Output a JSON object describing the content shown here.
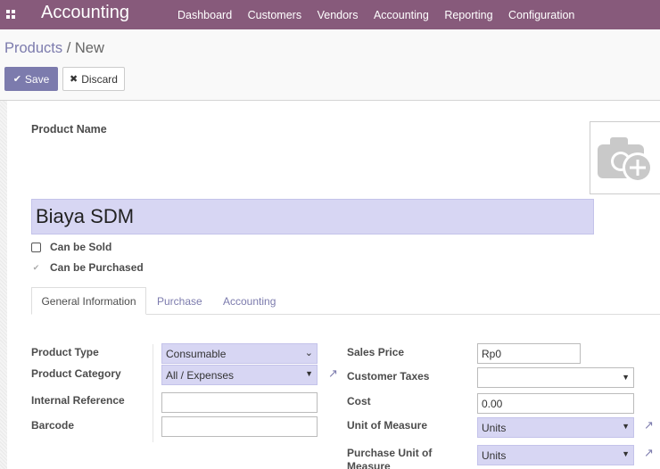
{
  "navbar": {
    "app_title": "Accounting",
    "menu": [
      "Dashboard",
      "Customers",
      "Vendors",
      "Accounting",
      "Reporting",
      "Configuration"
    ]
  },
  "breadcrumb": {
    "parent": "Products",
    "separator": " / ",
    "current": "New"
  },
  "buttons": {
    "save": "Save",
    "discard": "Discard"
  },
  "product": {
    "name_label": "Product Name",
    "name": "Biaya SDM",
    "can_be_sold_label": "Can be Sold",
    "can_be_sold": false,
    "can_be_purchased_label": "Can be Purchased",
    "can_be_purchased": true
  },
  "tabs": [
    "General Information",
    "Purchase",
    "Accounting"
  ],
  "general": {
    "left": {
      "product_type_label": "Product Type",
      "product_type": "Consumable",
      "product_category_label": "Product Category",
      "product_category": "All / Expenses",
      "internal_reference_label": "Internal Reference",
      "internal_reference": "",
      "barcode_label": "Barcode",
      "barcode": ""
    },
    "right": {
      "sales_price_label": "Sales Price",
      "sales_price": "Rp0",
      "customer_taxes_label": "Customer Taxes",
      "customer_taxes": "",
      "cost_label": "Cost",
      "cost": "0.00",
      "uom_label": "Unit of Measure",
      "uom": "Units",
      "purchase_uom_label": "Purchase Unit of Measure",
      "purchase_uom": "Units"
    }
  },
  "colors": {
    "navbar": "#875a7b",
    "primary": "#7c7bad",
    "required_bg": "#d7d6f3"
  }
}
